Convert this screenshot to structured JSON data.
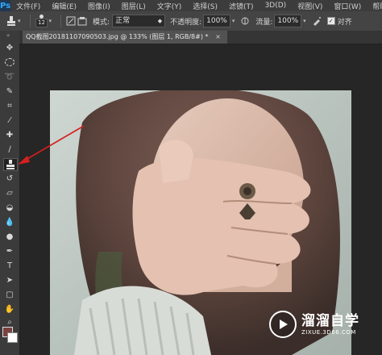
{
  "app": {
    "logo": "Ps"
  },
  "menu": [
    "文件(F)",
    "编辑(E)",
    "图像(I)",
    "图层(L)",
    "文字(Y)",
    "选择(S)",
    "滤镜(T)",
    "3D(D)",
    "视图(V)",
    "窗口(W)",
    "帮助(H)"
  ],
  "options": {
    "brush_size": "12",
    "mode_label": "模式:",
    "mode_value": "正常",
    "opacity_label": "不透明度:",
    "opacity_value": "100%",
    "flow_label": "流量:",
    "flow_value": "100%",
    "aligned_label": "对齐"
  },
  "document": {
    "tab_title": "QQ截图20181107090503.jpg @ 133% (图层 1, RGB/8#) *"
  },
  "colors": {
    "foreground": "#7b4040",
    "background": "#ffffff",
    "annotation_arrow": "#d42020"
  },
  "watermark": {
    "title": "溜溜自学",
    "url": "ZIXUE.3D66.COM"
  },
  "tools": [
    "move-tool",
    "marquee-tool",
    "lasso-tool",
    "quick-select-tool",
    "crop-tool",
    "eyedropper-tool",
    "spot-healing-tool",
    "brush-tool",
    "clone-stamp-tool",
    "history-brush-tool",
    "eraser-tool",
    "paint-bucket-tool",
    "blur-tool",
    "dodge-tool",
    "pen-tool",
    "type-tool",
    "path-select-tool",
    "shape-tool",
    "hand-tool",
    "zoom-tool"
  ]
}
